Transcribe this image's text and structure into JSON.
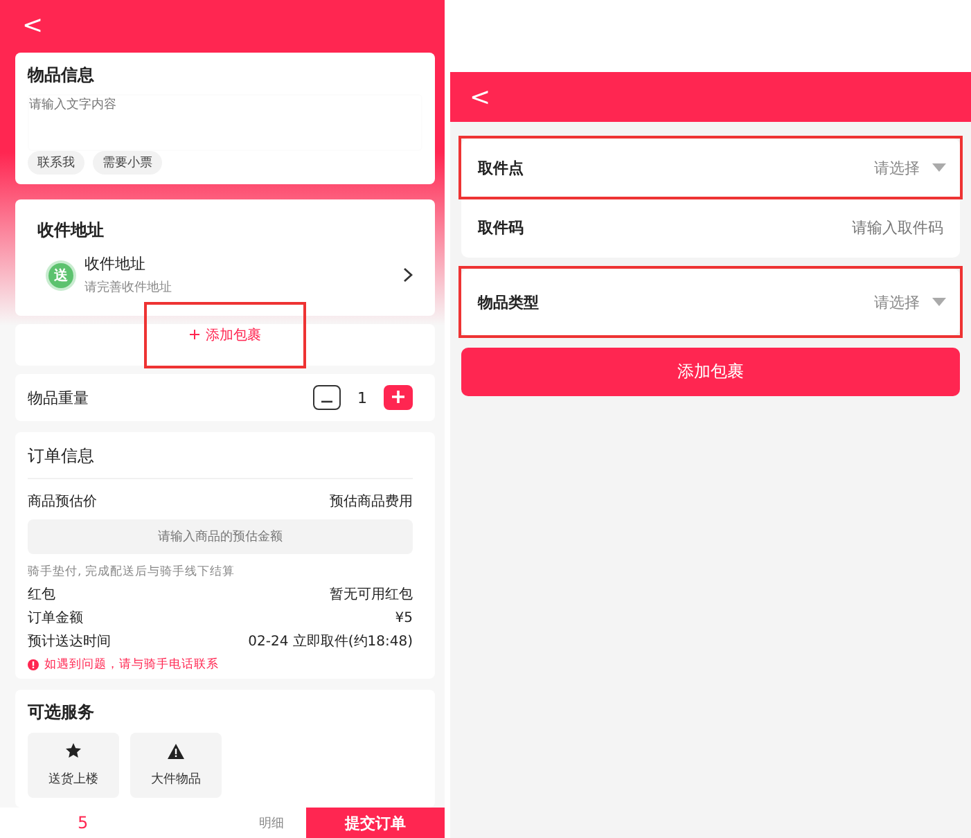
{
  "left_screen": {
    "back": "<",
    "item_info": {
      "title": "物品信息",
      "placeholder": "请输入文字内容",
      "tags": [
        {
          "label": "联系我",
          "selected": false
        },
        {
          "label": "需要小票",
          "selected": false
        }
      ]
    },
    "address": {
      "title": "收件地址",
      "badge": "送",
      "label": "收件地址",
      "hint": "请完善收件地址"
    },
    "add_package": {
      "label": "添加包裹",
      "highlighted": true
    },
    "weight": {
      "label": "物品重量",
      "value": "1"
    },
    "order_info": {
      "title": "订单信息",
      "price_label": "商品预估价",
      "price_hint": "预估商品费用",
      "price_placeholder": "请输入商品的预估金额",
      "note": "骑手垫付, 完成配送后与骑手线下结算",
      "rows": [
        {
          "label": "红包",
          "value": "暂无可用红包"
        },
        {
          "label": "订单金额",
          "value": "¥5"
        },
        {
          "label": "预计送达时间",
          "value": "02-24 立即取件(约18:48)"
        }
      ],
      "warning": "如遇到问题，请与骑手电话联系"
    },
    "services": {
      "title": "可选服务",
      "items": [
        {
          "kind": "star",
          "label": "送货上楼"
        },
        {
          "kind": "warning",
          "label": "大件物品"
        }
      ]
    },
    "bottom_bar": {
      "amount": "5",
      "details": "明细",
      "submit": "提交订单"
    }
  },
  "right_screen": {
    "back": "<",
    "groups": [
      [
        {
          "label": "取件点",
          "kind": "select",
          "placeholder": "请选择",
          "highlighted": true
        },
        {
          "label": "取件码",
          "kind": "input",
          "placeholder": "请输入取件码",
          "highlighted": false
        }
      ],
      [
        {
          "label": "物品类型",
          "kind": "select",
          "placeholder": "请选择",
          "highlighted": true
        }
      ]
    ],
    "button": "添加包裹"
  }
}
